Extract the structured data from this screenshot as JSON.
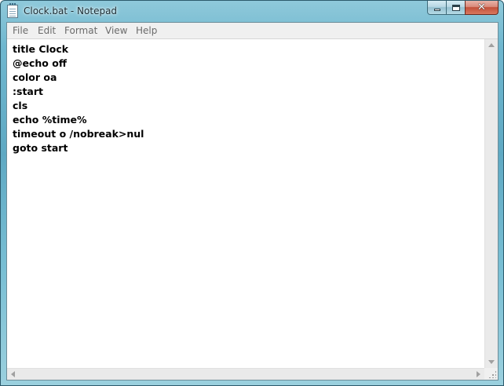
{
  "window": {
    "title": "Clock.bat - Notepad",
    "controls": {
      "minimize": "minimize",
      "maximize": "maximize",
      "close": "close"
    }
  },
  "menu": {
    "items": [
      "File",
      "Edit",
      "Format",
      "View",
      "Help"
    ]
  },
  "editor": {
    "lines": [
      "title Clock",
      "@echo off",
      "color oa",
      ":start",
      "cls",
      "echo %time%",
      "timeout o /nobreak>nul",
      "goto start"
    ]
  },
  "icons": {
    "app": "notepad-icon",
    "close": "close-icon",
    "minimize": "minimize-icon",
    "maximize": "maximize-icon"
  },
  "colors": {
    "title_gradient": "#6fb7cf",
    "close_button": "#c2503a",
    "menu_text": "#6b6b6b"
  }
}
